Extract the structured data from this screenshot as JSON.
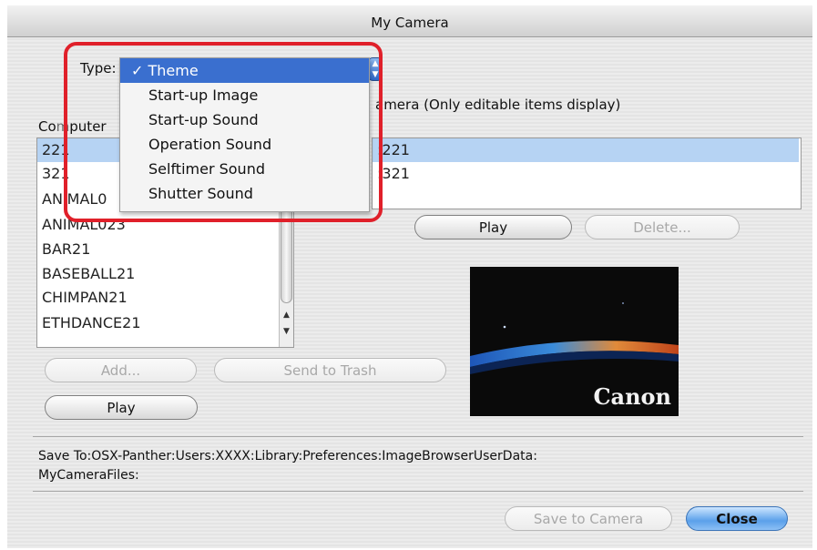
{
  "window": {
    "title": "My Camera"
  },
  "type_selector": {
    "label": "Type:",
    "options": [
      "Theme",
      "Start-up Image",
      "Start-up Sound",
      "Operation Sound",
      "Selftimer Sound",
      "Shutter Sound"
    ],
    "selected": "Theme",
    "check_mark": "✓"
  },
  "computer": {
    "label_visible": "Co",
    "label_visible_tail": "puter",
    "items": [
      "221",
      "321",
      "ANIMAL0",
      "ANIMAL023",
      "BAR21",
      "BASEBALL21",
      "CHIMPAN21",
      "ETHDANCE21"
    ],
    "selected_index": 0,
    "add_label": "Add...",
    "trash_label": "Send to Trash",
    "play_label": "Play"
  },
  "camera": {
    "label": "amera (Only editable items display)",
    "items": [
      ":221",
      ":321"
    ],
    "selected_index": 0,
    "play_label": "Play",
    "delete_label": "Delete..."
  },
  "preview": {
    "brand": "Canon"
  },
  "save_to": {
    "line1": "Save To:OSX-Panther:Users:XXXX:Library:Preferences:ImageBrowserUserData:",
    "line2": "MyCameraFiles:"
  },
  "footer": {
    "save_label": "Save to Camera",
    "close_label": "Close"
  },
  "colors": {
    "highlight": "#3a6fcf",
    "selection": "#b6d3f3",
    "annotation": "#e0202a",
    "default_button": "#5aa0ea"
  }
}
